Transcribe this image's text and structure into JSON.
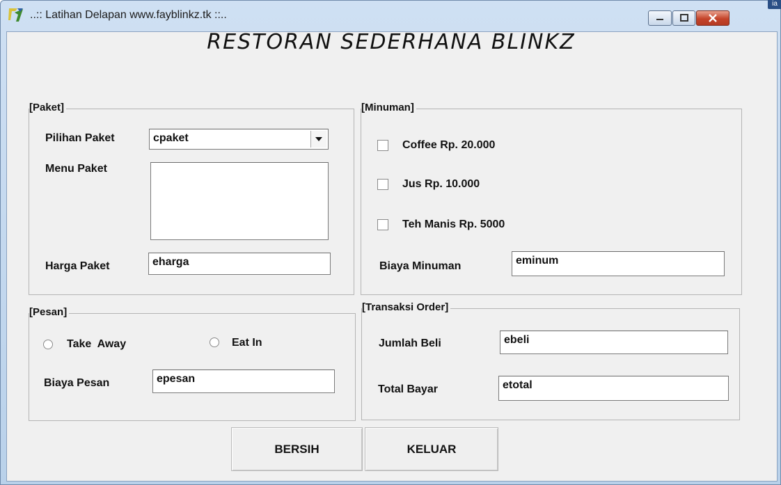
{
  "window": {
    "title": "..:: Latihan Delapan www.fayblinkz.tk ::..",
    "corner_tag": "ia"
  },
  "heading": "RESTORAN SEDERHANA BLINKZ",
  "paket": {
    "group_label": "[Paket]",
    "pilihan_label": "Pilihan Paket",
    "pilihan_value": "cpaket",
    "menu_label": "Menu Paket",
    "menu_value": "",
    "harga_label": "Harga Paket",
    "harga_value": "eharga"
  },
  "minuman": {
    "group_label": "[Minuman]",
    "items": [
      {
        "label": "Coffee Rp. 20.000",
        "checked": false
      },
      {
        "label": "Jus Rp. 10.000",
        "checked": false
      },
      {
        "label": "Teh Manis Rp. 5000",
        "checked": false
      }
    ],
    "biaya_label": "Biaya Minuman",
    "biaya_value": "eminum"
  },
  "pesan": {
    "group_label": "[Pesan]",
    "option_takeaway": "Take  Away",
    "option_eatin": "Eat In",
    "biaya_label": "Biaya Pesan",
    "biaya_value": "epesan"
  },
  "transaksi": {
    "group_label": "[Transaksi Order]",
    "jumlah_label": "Jumlah Beli",
    "jumlah_value": "ebeli",
    "total_label": "Total Bayar",
    "total_value": "etotal"
  },
  "buttons": {
    "bersih": "BERSIH",
    "keluar": "KELUAR"
  }
}
